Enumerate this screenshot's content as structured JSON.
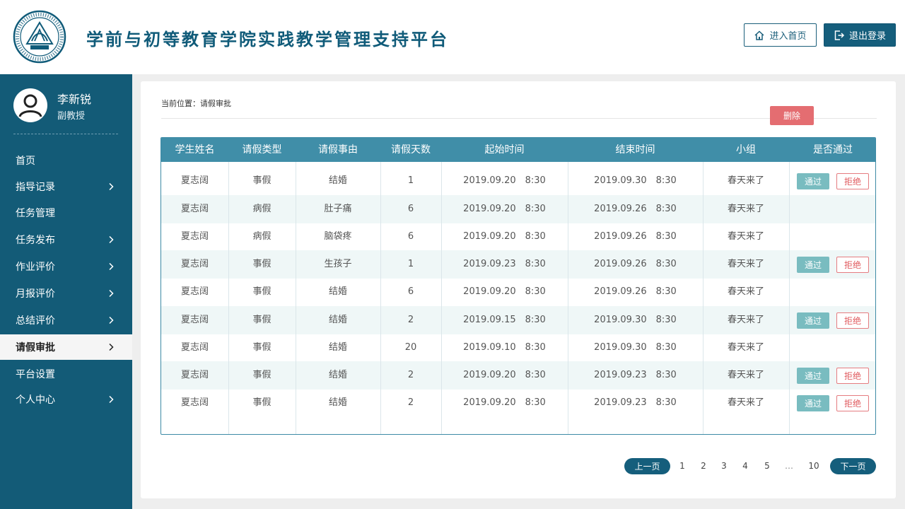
{
  "header": {
    "title": "学前与初等教育学院实践教学管理支持平台",
    "home_label": "进入首页",
    "logout_label": "退出登录",
    "logo_text": "SHENYANG NORMAL UNIVERSITY 1951",
    "accent": "#155e7c"
  },
  "user": {
    "name": "李新锐",
    "role": "副教授"
  },
  "sidebar": {
    "items": [
      {
        "label": "首页",
        "has_arrow": false
      },
      {
        "label": "指导记录",
        "has_arrow": true
      },
      {
        "label": "任务管理",
        "has_arrow": false
      },
      {
        "label": "任务发布",
        "has_arrow": true
      },
      {
        "label": "作业评价",
        "has_arrow": true
      },
      {
        "label": "月报评价",
        "has_arrow": true
      },
      {
        "label": "总结评价",
        "has_arrow": true
      },
      {
        "label": "请假审批",
        "has_arrow": true,
        "active": true
      },
      {
        "label": "平台设置",
        "has_arrow": false
      },
      {
        "label": "个人中心",
        "has_arrow": true
      }
    ]
  },
  "breadcrumb": "当前位置：请假审批",
  "delete_label": "删除",
  "table": {
    "headers": [
      "学生姓名",
      "请假类型",
      "请假事由",
      "请假天数",
      "起始时间",
      "结束时间",
      "小组",
      "是否通过"
    ],
    "approve_label": "通过",
    "reject_label": "拒绝",
    "rows": [
      {
        "cells": [
          "夏志阔",
          "事假",
          "结婚",
          "1",
          "2019.09.20　8:30",
          "2019.09.30　8:30",
          "春天来了"
        ],
        "actions": true
      },
      {
        "cells": [
          "夏志阔",
          "病假",
          "肚子痛",
          "6",
          "2019.09.20　8:30",
          "2019.09.26　8:30",
          "春天来了"
        ],
        "actions": false
      },
      {
        "cells": [
          "夏志阔",
          "病假",
          "脑袋疼",
          "6",
          "2019.09.20　8:30",
          "2019.09.26　8:30",
          "春天来了"
        ],
        "actions": false
      },
      {
        "cells": [
          "夏志阔",
          "事假",
          "生孩子",
          "1",
          "2019.09.23　8:30",
          "2019.09.26　8:30",
          "春天来了"
        ],
        "actions": true
      },
      {
        "cells": [
          "夏志阔",
          "事假",
          "结婚",
          "6",
          "2019.09.20　8:30",
          "2019.09.26　8:30",
          "春天来了"
        ],
        "actions": false
      },
      {
        "cells": [
          "夏志阔",
          "事假",
          "结婚",
          "2",
          "2019.09.15　8:30",
          "2019.09.30　8:30",
          "春天来了"
        ],
        "actions": true
      },
      {
        "cells": [
          "夏志阔",
          "事假",
          "结婚",
          "20",
          "2019.09.10　8:30",
          "2019.09.30　8:30",
          "春天来了"
        ],
        "actions": false
      },
      {
        "cells": [
          "夏志阔",
          "事假",
          "结婚",
          "2",
          "2019.09.20　8:30",
          "2019.09.23　8:30",
          "春天来了"
        ],
        "actions": true
      },
      {
        "cells": [
          "夏志阔",
          "事假",
          "结婚",
          "2",
          "2019.09.20　8:30",
          "2019.09.23　8:30",
          "春天来了"
        ],
        "actions": true
      }
    ]
  },
  "pagination": {
    "prev_label": "上一页",
    "next_label": "下一页",
    "pages": [
      "1",
      "2",
      "3",
      "4",
      "5"
    ],
    "ellipsis": "…",
    "last_page": "10"
  }
}
